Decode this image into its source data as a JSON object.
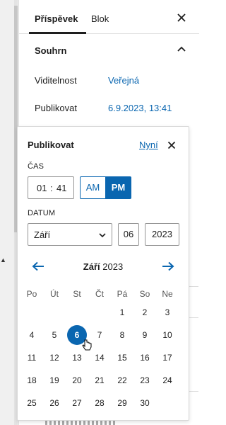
{
  "sidebar": {
    "tabs": [
      {
        "label": "Příspěvek",
        "active": true
      },
      {
        "label": "Blok",
        "active": false
      }
    ],
    "panel_title": "Souhrn",
    "rows": [
      {
        "label": "Viditelnost",
        "value": "Veřejná"
      },
      {
        "label": "Publikovat",
        "value": "6.9.2023, 13:41"
      }
    ]
  },
  "popover": {
    "title": "Publikovat",
    "now_link": "Nyní",
    "time_label": "ČAS",
    "hours": "01",
    "minutes": "41",
    "separator": ":",
    "am": "AM",
    "pm": "PM",
    "selected_period": "PM",
    "date_label": "DATUM",
    "month_value": "Září",
    "day_value": "06",
    "year_value": "2023",
    "calendar_month": "Září",
    "calendar_year": "2023",
    "weekdays": [
      "Po",
      "Út",
      "St",
      "Čt",
      "Pá",
      "So",
      "Ne"
    ],
    "days": [
      "1",
      "2",
      "3",
      "4",
      "5",
      "6",
      "7",
      "8",
      "9",
      "10",
      "11",
      "12",
      "13",
      "14",
      "15",
      "16",
      "17",
      "18",
      "19",
      "20",
      "21",
      "22",
      "23",
      "24",
      "25",
      "26",
      "27",
      "28",
      "29",
      "30"
    ],
    "first_weekday_index": 4,
    "selected_day": "6"
  },
  "colors": {
    "accent": "#0a66b0",
    "text": "#1e1e1e",
    "border": "#949494"
  }
}
